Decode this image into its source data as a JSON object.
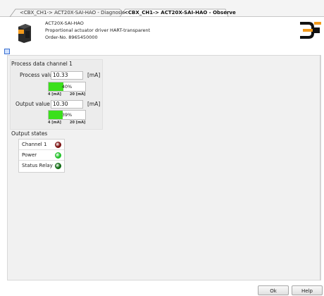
{
  "tabs": [
    {
      "label": "<CBX_CH1-> ACT20X-SAI-HAO - Diagnosis",
      "active": false
    },
    {
      "label": "<CBX_CH1-> ACT20X-SAI-HAO - Observe",
      "active": true
    }
  ],
  "device": {
    "name": "ACT20X-SAI-HAO",
    "description": "Proportional actuator driver HART-transparent",
    "order_no": "Order-No. 8965450000"
  },
  "process_group": {
    "title": "Process data channel 1",
    "process_value": {
      "label": "Process value",
      "value": "10.33",
      "unit": "[mA]",
      "percent": 40,
      "percent_text": "40%",
      "min_label": "4 [mA]",
      "max_label": "20 [mA]"
    },
    "output_value": {
      "label": "Output value",
      "value": "10.30",
      "unit": "[mA]",
      "percent": 39,
      "percent_text": "39%",
      "min_label": "4 [mA]",
      "max_label": "20 [mA]"
    }
  },
  "output_states": {
    "title": "Output states",
    "rows": [
      {
        "label": "Channel 1",
        "color": "#7a1010"
      },
      {
        "label": "Power",
        "color": "#22c22a"
      },
      {
        "label": "Status Relay",
        "color": "#0f6a12"
      }
    ]
  },
  "buttons": {
    "ok": "Ok",
    "help": "Help"
  },
  "colors": {
    "bar_fill": "#3be01b",
    "logo_black": "#111111",
    "logo_orange": "#f39a1b"
  },
  "icons": {
    "device": "device-module-icon",
    "logo": "weidmueller-logo",
    "collapse": "collapse-icon"
  }
}
